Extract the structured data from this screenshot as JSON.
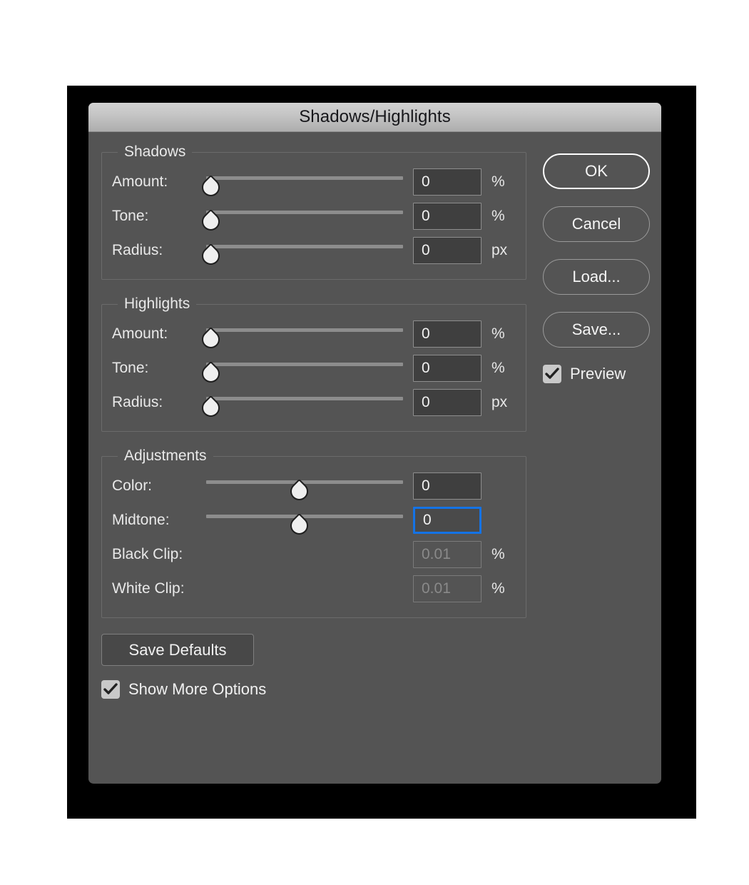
{
  "window": {
    "title": "Shadows/Highlights"
  },
  "groups": [
    {
      "legend": "Shadows",
      "rows": [
        {
          "label": "Amount:",
          "value": "0",
          "unit": "%",
          "slider": true,
          "thumb_pct": 2,
          "disabled": false,
          "focused": false
        },
        {
          "label": "Tone:",
          "value": "0",
          "unit": "%",
          "slider": true,
          "thumb_pct": 2,
          "disabled": false,
          "focused": false
        },
        {
          "label": "Radius:",
          "value": "0",
          "unit": "px",
          "slider": true,
          "thumb_pct": 2,
          "disabled": false,
          "focused": false
        }
      ]
    },
    {
      "legend": "Highlights",
      "rows": [
        {
          "label": "Amount:",
          "value": "0",
          "unit": "%",
          "slider": true,
          "thumb_pct": 2,
          "disabled": false,
          "focused": false
        },
        {
          "label": "Tone:",
          "value": "0",
          "unit": "%",
          "slider": true,
          "thumb_pct": 2,
          "disabled": false,
          "focused": false
        },
        {
          "label": "Radius:",
          "value": "0",
          "unit": "px",
          "slider": true,
          "thumb_pct": 2,
          "disabled": false,
          "focused": false
        }
      ]
    },
    {
      "legend": "Adjustments",
      "rows": [
        {
          "label": "Color:",
          "value": "0",
          "unit": "",
          "slider": true,
          "thumb_pct": 47,
          "disabled": false,
          "focused": false
        },
        {
          "label": "Midtone:",
          "value": "0",
          "unit": "",
          "slider": true,
          "thumb_pct": 47,
          "disabled": false,
          "focused": true
        },
        {
          "label": "Black Clip:",
          "value": "0.01",
          "unit": "%",
          "slider": false,
          "thumb_pct": 0,
          "disabled": true,
          "focused": false
        },
        {
          "label": "White Clip:",
          "value": "0.01",
          "unit": "%",
          "slider": false,
          "thumb_pct": 0,
          "disabled": true,
          "focused": false
        }
      ]
    }
  ],
  "bottom": {
    "save_defaults_label": "Save Defaults",
    "show_more_options_label": "Show More Options",
    "show_more_options_checked": true
  },
  "buttons": [
    {
      "label": "OK",
      "default": true
    },
    {
      "label": "Cancel",
      "default": false
    },
    {
      "label": "Load...",
      "default": false
    },
    {
      "label": "Save...",
      "default": false
    }
  ],
  "preview": {
    "label": "Preview",
    "checked": true
  },
  "colors": {
    "dialog_bg": "#545454",
    "titlebar_top": "#d2d2d2",
    "titlebar_bottom": "#aeaeae",
    "field_bg": "#3f3f3f",
    "focus_blue": "#1473e6",
    "text": "#e9e9e9",
    "backdrop": "#000000"
  }
}
